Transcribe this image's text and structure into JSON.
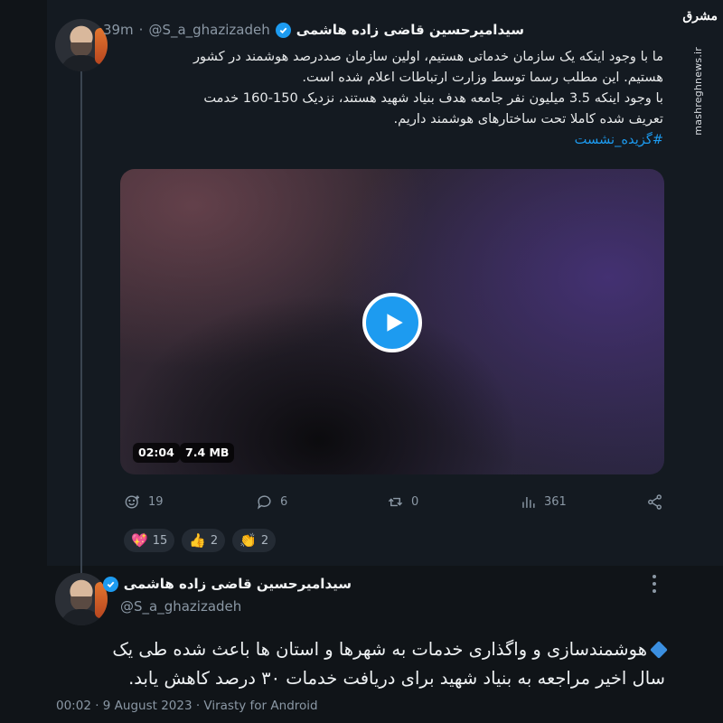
{
  "watermark": {
    "logo_text": "مشرق",
    "site": "mashreghnews.ir"
  },
  "tweet": {
    "author_name": "سیدامیرحسین قاضی زاده هاشمی",
    "handle": "@S_a_ghazizadeh",
    "separator": "·",
    "time_ago": "39m",
    "text_lines": [
      "ما با وجود اینکه یک سازمان خدماتی هستیم، اولین سازمان صددرصد هوشمند در کشور",
      "هستیم. این مطلب رسما توسط وزارت ارتباطات اعلام شده است.",
      "با وجود اینکه 3.5 میلیون نفر جامعه هدف بنیاد شهید هستند، نزدیک 150-160 خدمت",
      "تعریف شده کاملا تحت ساختارهای هوشمند داریم."
    ],
    "hashtag": "#گزیده_نشست",
    "video": {
      "duration": "02:04",
      "size": "7.4 MB"
    },
    "actions": {
      "reactions_count": "19",
      "replies_count": "6",
      "reposts_count": "0",
      "views_count": "361"
    },
    "reactions": [
      {
        "icon": "heart-emoji",
        "emoji": "💖",
        "count": "15"
      },
      {
        "icon": "thumbs-up-emoji",
        "emoji": "👍",
        "count": "2"
      },
      {
        "icon": "clapping-hands-emoji",
        "emoji": "👏",
        "count": "2"
      }
    ]
  },
  "reply": {
    "author_name": "سیدامیرحسین قاضی زاده هاشمی",
    "handle": "@S_a_ghazizadeh",
    "text_lines": [
      "هوشمندسازی و واگذاری خدمات به شهرها و استان ها باعث شده طی یک",
      "سال اخیر مراجعه به بنیاد شهید برای دریافت خدمات ۳۰ درصد کاهش یابد."
    ],
    "meta": "00:02 · 9 August 2023 · Virasty for Android"
  },
  "colors": {
    "accent": "#1d9bf0",
    "background": "#101418",
    "muted_text": "#8b98a5"
  }
}
